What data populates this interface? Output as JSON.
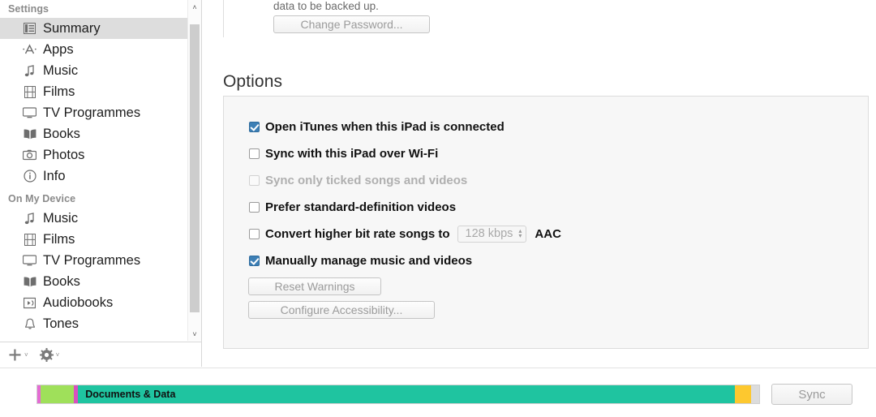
{
  "sidebar": {
    "sections": [
      {
        "header": "Settings",
        "items": [
          {
            "label": "Summary",
            "icon": "summary-icon",
            "selected": true
          },
          {
            "label": "Apps",
            "icon": "apps-icon",
            "selected": false
          },
          {
            "label": "Music",
            "icon": "music-note-icon",
            "selected": false
          },
          {
            "label": "Films",
            "icon": "film-strip-icon",
            "selected": false
          },
          {
            "label": "TV Programmes",
            "icon": "tv-icon",
            "selected": false
          },
          {
            "label": "Books",
            "icon": "book-icon",
            "selected": false
          },
          {
            "label": "Photos",
            "icon": "camera-icon",
            "selected": false
          },
          {
            "label": "Info",
            "icon": "info-circle-icon",
            "selected": false
          }
        ]
      },
      {
        "header": "On My Device",
        "items": [
          {
            "label": "Music",
            "icon": "music-note-icon",
            "selected": false
          },
          {
            "label": "Films",
            "icon": "film-strip-icon",
            "selected": false
          },
          {
            "label": "TV Programmes",
            "icon": "tv-icon",
            "selected": false
          },
          {
            "label": "Books",
            "icon": "book-icon",
            "selected": false
          },
          {
            "label": "Audiobooks",
            "icon": "audiobook-icon",
            "selected": false
          },
          {
            "label": "Tones",
            "icon": "bell-icon",
            "selected": false
          }
        ]
      }
    ],
    "toolbar": {
      "add_icon": "plus-icon",
      "add_caret": "˅",
      "settings_icon": "gear-icon",
      "settings_caret": "˅"
    },
    "scrollbar": {
      "up_arrow": "˄",
      "down_arrow": "˅"
    }
  },
  "main": {
    "backup_note": "data to be backed up.",
    "change_password_label": "Change Password...",
    "options_title": "Options",
    "options": [
      {
        "label": "Open iTunes when this iPad is connected",
        "checked": true,
        "disabled": false
      },
      {
        "label": "Sync with this iPad over Wi-Fi",
        "checked": false,
        "disabled": false
      },
      {
        "label": "Sync only ticked songs and videos",
        "checked": false,
        "disabled": true
      },
      {
        "label": "Prefer standard-definition videos",
        "checked": false,
        "disabled": false
      },
      {
        "label": "Convert higher bit rate songs to",
        "checked": false,
        "disabled": false
      },
      {
        "label": "Manually manage music and videos",
        "checked": true,
        "disabled": false
      }
    ],
    "bitrate_select": {
      "value": "128 kbps",
      "stepper_up": "▴",
      "stepper_down": "▾"
    },
    "codec_label": "AAC",
    "reset_warnings_label": "Reset Warnings",
    "configure_accessibility_label": "Configure Accessibility..."
  },
  "bottom": {
    "capacity_segments": [
      {
        "name": "apps",
        "label": "",
        "color": "#e46bd4",
        "width_pct": 0.45
      },
      {
        "name": "media",
        "label": "",
        "color": "#9fe05a",
        "width_pct": 4.6
      },
      {
        "name": "photos",
        "label": "",
        "color": "#d94fbf",
        "width_pct": 0.6
      },
      {
        "name": "documents-data",
        "label": "Documents & Data",
        "color": "#1fc4a0",
        "width_pct": 91.0
      },
      {
        "name": "other",
        "label": "",
        "color": "#fdc82f",
        "width_pct": 2.2
      },
      {
        "name": "free-space",
        "label": "",
        "color": "#dcdcdc",
        "width_pct": 1.15
      }
    ],
    "sync_label": "Sync"
  }
}
